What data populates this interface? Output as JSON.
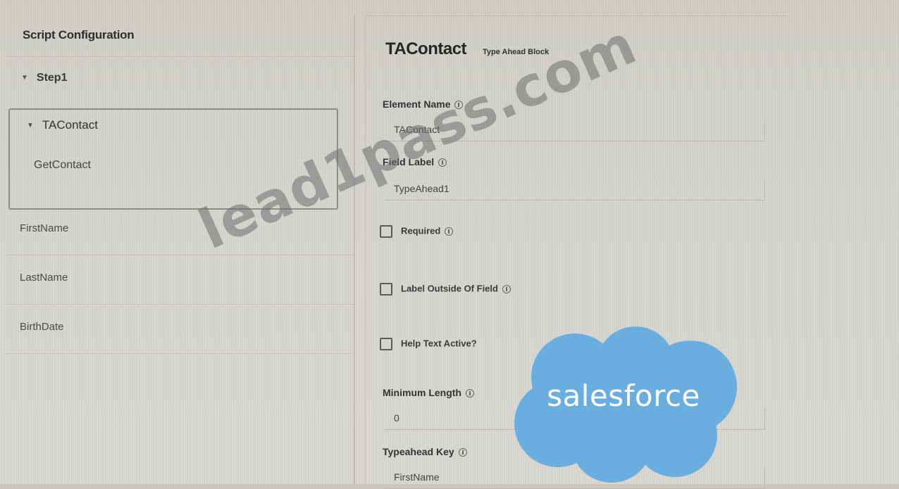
{
  "left": {
    "title": "Script Configuration",
    "step": "Step1",
    "block_name": "TAContact",
    "block_child": "GetContact",
    "fields": [
      "FirstName",
      "LastName",
      "BirthDate"
    ]
  },
  "right": {
    "block_title": "TAContact",
    "block_type": "Type Ahead Block",
    "element_name_label": "Element Name",
    "element_name_value": "TAContact",
    "field_label_label": "Field Label",
    "field_label_value": "TypeAhead1",
    "required_label": "Required",
    "label_outside_label": "Label Outside Of Field",
    "help_text_label": "Help Text Active?",
    "min_length_label": "Minimum Length",
    "min_length_value": "0",
    "typeahead_key_label": "Typeahead Key",
    "typeahead_key_value": "FirstName",
    "required_checked": false,
    "label_outside_checked": false,
    "help_text_checked": false
  },
  "watermark": "lead1pass.com",
  "logo": {
    "text": "salesforce",
    "color": "#6aaee0"
  }
}
